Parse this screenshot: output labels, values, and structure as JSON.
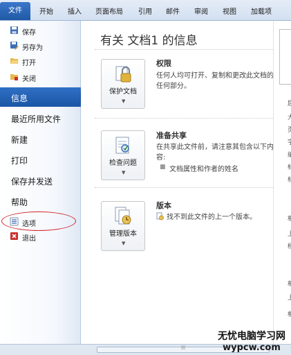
{
  "ribbon": {
    "tabs": [
      "文件",
      "开始",
      "插入",
      "页面布局",
      "引用",
      "邮件",
      "审阅",
      "视图",
      "加载项"
    ]
  },
  "sidebar": {
    "commands": [
      "保存",
      "另存为",
      "打开",
      "关闭"
    ],
    "nav": [
      "信息",
      "最近所用文件",
      "新建",
      "打印",
      "保存并发送",
      "帮助"
    ],
    "options": [
      "选项",
      "退出"
    ],
    "active": "信息"
  },
  "info": {
    "title": "有关 文档1 的信息",
    "permissions": {
      "button": "保护文档",
      "heading": "权限",
      "text": "任何人均可打开、复制和更改此文档的任何部分。"
    },
    "prepare": {
      "button": "检查问题",
      "heading": "准备共享",
      "text": "在共享此文件前，请注意其包含以下内容:",
      "bullet": "文档属性和作者的姓名"
    },
    "versions": {
      "button": "管理版本",
      "heading": "版本",
      "text": "找不到此文件的上一个版本。"
    }
  },
  "right_column_glyphs": [
    "屈",
    "大",
    "页",
    "字",
    "编",
    "标",
    "标",
    "相",
    "上",
    "杨",
    "相",
    "上",
    "相"
  ],
  "watermark": {
    "line1": "无忧电脑学习网",
    "line2": "wypcw.com"
  },
  "colors": {
    "ribbon_file_tab": "#1f5aa6",
    "active_nav": "#1b56a5",
    "highlight_ellipse": "#d3242c"
  }
}
